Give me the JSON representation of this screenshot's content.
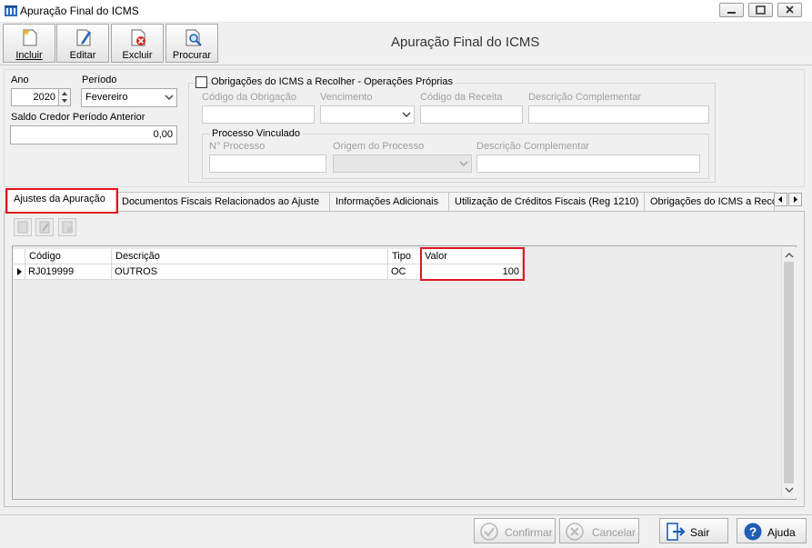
{
  "window": {
    "title": "Apuração Final do ICMS"
  },
  "toolbar": {
    "incluir": "Incluir",
    "editar": "Editar",
    "excluir": "Excluir",
    "procurar": "Procurar"
  },
  "header": {
    "title": "Apuração Final do ICMS"
  },
  "form": {
    "ano_label": "Ano",
    "ano_value": "2020",
    "periodo_label": "Período",
    "periodo_value": "Fevereiro",
    "saldo_label": "Saldo Credor Período Anterior",
    "saldo_value": "0,00",
    "obrig_checkbox_label": "Obrigações do ICMS a Recolher - Operações Próprias",
    "cod_obrig_label": "Código da Obrigação",
    "vencimento_label": "Vencimento",
    "cod_receita_label": "Código da Receita",
    "desc_compl_label": "Descrição Complementar",
    "processo_group_label": "Processo Vinculado",
    "num_processo_label": "N° Processo",
    "origem_label": "Origem do Processo",
    "desc_compl2_label": "Descrição Complementar"
  },
  "tabs": [
    {
      "label": "Ajustes da Apuração"
    },
    {
      "label": "Documentos Fiscais Relacionados ao Ajuste"
    },
    {
      "label": "Informações Adicionais"
    },
    {
      "label": "Utilização de Créditos Fiscais (Reg 1210)"
    },
    {
      "label": "Obrigações do ICMS a Recolher"
    }
  ],
  "grid": {
    "columns": [
      "Código",
      "Descrição",
      "Tipo",
      "Valor"
    ],
    "rows": [
      {
        "codigo": "RJ019999",
        "descricao": "OUTROS",
        "tipo": "OC",
        "valor": "100"
      }
    ]
  },
  "footer": {
    "confirmar": "Confirmar",
    "cancelar": "Cancelar",
    "sair": "Sair",
    "ajuda": "Ajuda"
  },
  "colors": {
    "highlight": "#e0141e",
    "accent": "#1e5fb4"
  }
}
